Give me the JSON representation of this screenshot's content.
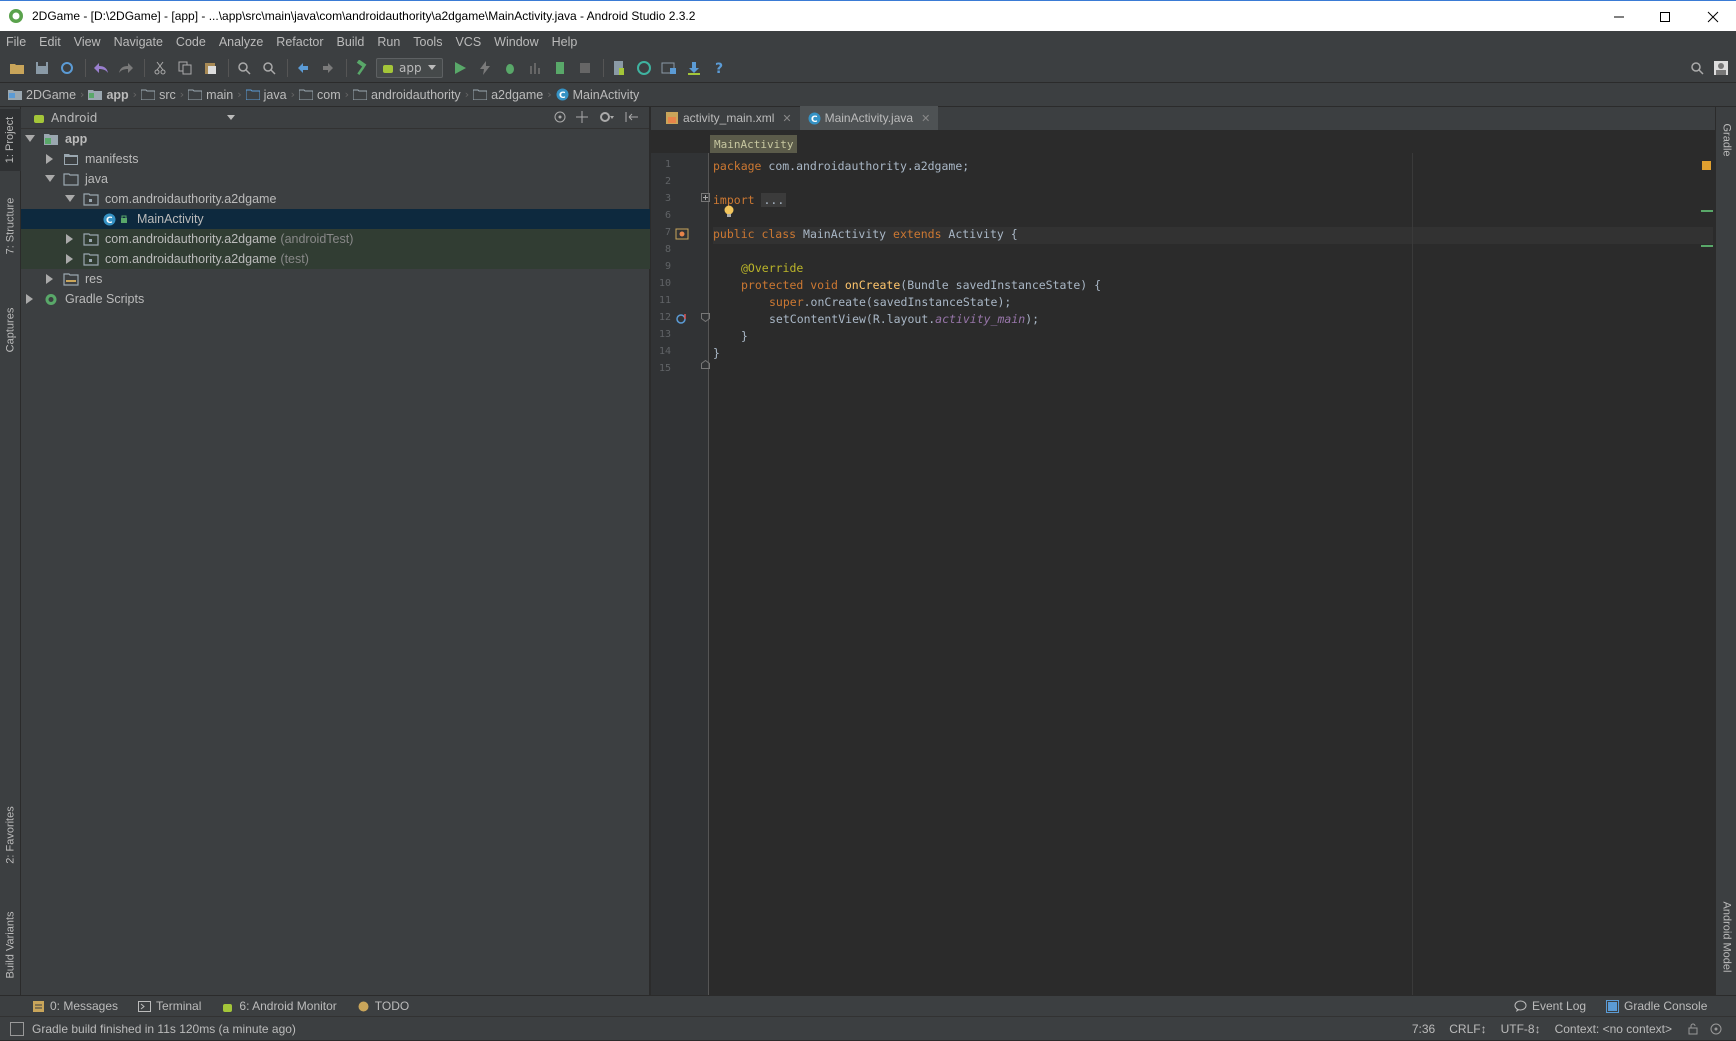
{
  "window": {
    "title": "2DGame - [D:\\2DGame] - [app] - ...\\app\\src\\main\\java\\com\\androidauthority\\a2dgame\\MainActivity.java - Android Studio 2.3.2"
  },
  "menu": [
    "File",
    "Edit",
    "View",
    "Navigate",
    "Code",
    "Analyze",
    "Refactor",
    "Build",
    "Run",
    "Tools",
    "VCS",
    "Window",
    "Help"
  ],
  "toolbar": {
    "run_config": "app"
  },
  "breadcrumb": [
    "2DGame",
    "app",
    "src",
    "main",
    "java",
    "com",
    "androidauthority",
    "a2dgame",
    "MainActivity"
  ],
  "left_strip": {
    "project": "1: Project",
    "structure": "7: Structure",
    "captures": "Captures",
    "favorites": "2: Favorites",
    "build_variants": "Build Variants"
  },
  "right_strip": {
    "gradle": "Gradle",
    "android_model": "Android Model"
  },
  "project_panel": {
    "view_mode": "Android",
    "tree": [
      {
        "label": "app",
        "suffix": ""
      },
      {
        "label": "manifests",
        "suffix": ""
      },
      {
        "label": "java",
        "suffix": ""
      },
      {
        "label": "com.androidauthority.a2dgame",
        "suffix": ""
      },
      {
        "label": "MainActivity",
        "suffix": ""
      },
      {
        "label": "com.androidauthority.a2dgame",
        "suffix": "(androidTest)"
      },
      {
        "label": "com.androidauthority.a2dgame",
        "suffix": "(test)"
      },
      {
        "label": "res",
        "suffix": ""
      },
      {
        "label": "Gradle Scripts",
        "suffix": ""
      }
    ]
  },
  "editor": {
    "tabs": [
      {
        "label": "activity_main.xml"
      },
      {
        "label": "MainActivity.java"
      }
    ],
    "class_crumb": "MainActivity",
    "line_numbers": [
      "1",
      "2",
      "3",
      "6",
      "7",
      "8",
      "9",
      "10",
      "11",
      "12",
      "13",
      "14",
      "15"
    ],
    "code": {
      "l1_kw": "package",
      "l1_rest": " com.androidauthority.a2dgame;",
      "l3_kw": "import",
      "l3_fold": "...",
      "l7_kw1": "public class",
      "l7_mid": " MainActivity ",
      "l7_kw2": "extends",
      "l7_rest": " Activity {",
      "l9_ann": "@Override",
      "l10_kw": "protected void",
      "l10_fn": "onCreate",
      "l10_rest": "(Bundle savedInstanceState) {",
      "l11_kw": "super",
      "l11_rest": ".onCreate(savedInstanceState);",
      "l12_a": "setContentView(R.layout.",
      "l12_b": "activity_main",
      "l12_c": ");",
      "l13": "}",
      "l14": "}"
    }
  },
  "bottom_tabs": {
    "messages": "0: Messages",
    "terminal": "Terminal",
    "android_monitor": "6: Android Monitor",
    "todo": "TODO",
    "event_log": "Event Log",
    "gradle_console": "Gradle Console"
  },
  "status": {
    "message": "Gradle build finished in 11s 120ms (a minute ago)",
    "position": "7:36",
    "line_sep": "CRLF↕",
    "encoding": "UTF-8↕",
    "context": "Context: <no context>"
  }
}
